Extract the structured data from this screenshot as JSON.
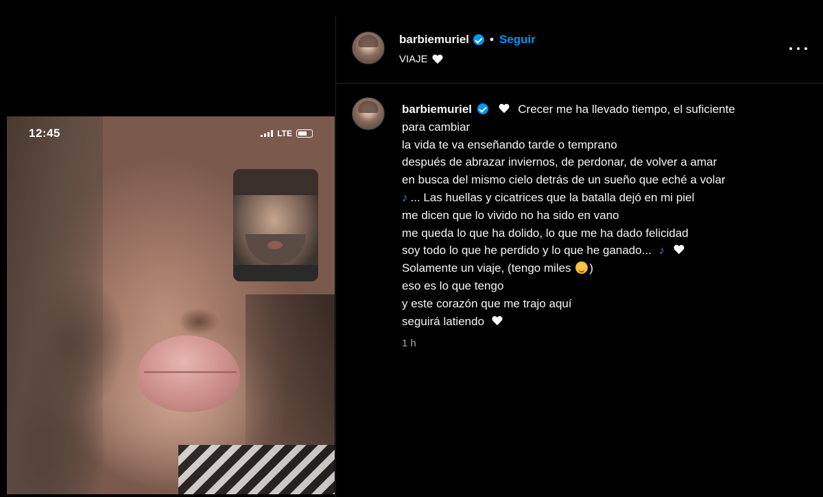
{
  "story": {
    "status_time": "12:45",
    "status_network": "LTE"
  },
  "post": {
    "username": "barbiemuriel",
    "follow_label": "Seguir",
    "separator": "•",
    "location": "VIAJE",
    "more_options_icon": "more-horizontal-icon",
    "accent_color": "#0095f6"
  },
  "caption": {
    "username": "barbiemuriel",
    "lines": [
      "Crecer me ha llevado tiempo, el suficiente",
      "para cambiar",
      "la vida te va enseñando tarde o temprano",
      "después de abrazar inviernos, de perdonar, de volver a amar",
      "en busca del mismo cielo detrás de un sueño que eché a volar",
      "... Las huellas y cicatrices que la batalla dejó en mi piel",
      "me dicen que lo vivido no ha sido en vano",
      "me queda lo que ha dolido, lo que me ha dado felicidad",
      "soy todo lo que he perdido y lo que he ganado...",
      "Solamente un viaje, (tengo miles",
      ")",
      "eso es lo que tengo",
      "y este corazón que me trajo aquí",
      "seguirá latiendo"
    ],
    "timestamp": "1 h"
  }
}
